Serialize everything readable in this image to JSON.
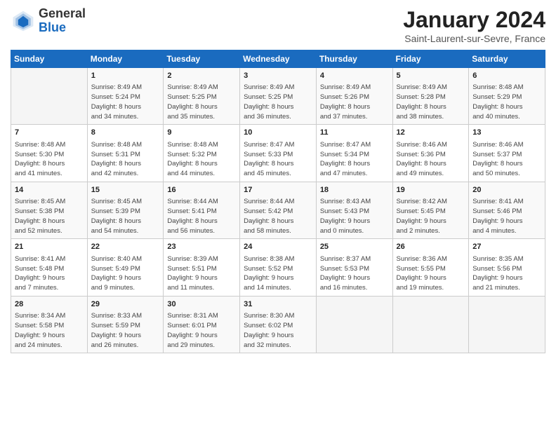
{
  "header": {
    "logo_general": "General",
    "logo_blue": "Blue",
    "title": "January 2024",
    "location": "Saint-Laurent-sur-Sevre, France"
  },
  "days_of_week": [
    "Sunday",
    "Monday",
    "Tuesday",
    "Wednesday",
    "Thursday",
    "Friday",
    "Saturday"
  ],
  "weeks": [
    [
      {
        "day": "",
        "sunrise": "",
        "sunset": "",
        "daylight": ""
      },
      {
        "day": "1",
        "sunrise": "Sunrise: 8:49 AM",
        "sunset": "Sunset: 5:24 PM",
        "daylight": "Daylight: 8 hours and 34 minutes."
      },
      {
        "day": "2",
        "sunrise": "Sunrise: 8:49 AM",
        "sunset": "Sunset: 5:25 PM",
        "daylight": "Daylight: 8 hours and 35 minutes."
      },
      {
        "day": "3",
        "sunrise": "Sunrise: 8:49 AM",
        "sunset": "Sunset: 5:25 PM",
        "daylight": "Daylight: 8 hours and 36 minutes."
      },
      {
        "day": "4",
        "sunrise": "Sunrise: 8:49 AM",
        "sunset": "Sunset: 5:26 PM",
        "daylight": "Daylight: 8 hours and 37 minutes."
      },
      {
        "day": "5",
        "sunrise": "Sunrise: 8:49 AM",
        "sunset": "Sunset: 5:28 PM",
        "daylight": "Daylight: 8 hours and 38 minutes."
      },
      {
        "day": "6",
        "sunrise": "Sunrise: 8:48 AM",
        "sunset": "Sunset: 5:29 PM",
        "daylight": "Daylight: 8 hours and 40 minutes."
      }
    ],
    [
      {
        "day": "7",
        "sunrise": "Sunrise: 8:48 AM",
        "sunset": "Sunset: 5:30 PM",
        "daylight": "Daylight: 8 hours and 41 minutes."
      },
      {
        "day": "8",
        "sunrise": "Sunrise: 8:48 AM",
        "sunset": "Sunset: 5:31 PM",
        "daylight": "Daylight: 8 hours and 42 minutes."
      },
      {
        "day": "9",
        "sunrise": "Sunrise: 8:48 AM",
        "sunset": "Sunset: 5:32 PM",
        "daylight": "Daylight: 8 hours and 44 minutes."
      },
      {
        "day": "10",
        "sunrise": "Sunrise: 8:47 AM",
        "sunset": "Sunset: 5:33 PM",
        "daylight": "Daylight: 8 hours and 45 minutes."
      },
      {
        "day": "11",
        "sunrise": "Sunrise: 8:47 AM",
        "sunset": "Sunset: 5:34 PM",
        "daylight": "Daylight: 8 hours and 47 minutes."
      },
      {
        "day": "12",
        "sunrise": "Sunrise: 8:46 AM",
        "sunset": "Sunset: 5:36 PM",
        "daylight": "Daylight: 8 hours and 49 minutes."
      },
      {
        "day": "13",
        "sunrise": "Sunrise: 8:46 AM",
        "sunset": "Sunset: 5:37 PM",
        "daylight": "Daylight: 8 hours and 50 minutes."
      }
    ],
    [
      {
        "day": "14",
        "sunrise": "Sunrise: 8:45 AM",
        "sunset": "Sunset: 5:38 PM",
        "daylight": "Daylight: 8 hours and 52 minutes."
      },
      {
        "day": "15",
        "sunrise": "Sunrise: 8:45 AM",
        "sunset": "Sunset: 5:39 PM",
        "daylight": "Daylight: 8 hours and 54 minutes."
      },
      {
        "day": "16",
        "sunrise": "Sunrise: 8:44 AM",
        "sunset": "Sunset: 5:41 PM",
        "daylight": "Daylight: 8 hours and 56 minutes."
      },
      {
        "day": "17",
        "sunrise": "Sunrise: 8:44 AM",
        "sunset": "Sunset: 5:42 PM",
        "daylight": "Daylight: 8 hours and 58 minutes."
      },
      {
        "day": "18",
        "sunrise": "Sunrise: 8:43 AM",
        "sunset": "Sunset: 5:43 PM",
        "daylight": "Daylight: 9 hours and 0 minutes."
      },
      {
        "day": "19",
        "sunrise": "Sunrise: 8:42 AM",
        "sunset": "Sunset: 5:45 PM",
        "daylight": "Daylight: 9 hours and 2 minutes."
      },
      {
        "day": "20",
        "sunrise": "Sunrise: 8:41 AM",
        "sunset": "Sunset: 5:46 PM",
        "daylight": "Daylight: 9 hours and 4 minutes."
      }
    ],
    [
      {
        "day": "21",
        "sunrise": "Sunrise: 8:41 AM",
        "sunset": "Sunset: 5:48 PM",
        "daylight": "Daylight: 9 hours and 7 minutes."
      },
      {
        "day": "22",
        "sunrise": "Sunrise: 8:40 AM",
        "sunset": "Sunset: 5:49 PM",
        "daylight": "Daylight: 9 hours and 9 minutes."
      },
      {
        "day": "23",
        "sunrise": "Sunrise: 8:39 AM",
        "sunset": "Sunset: 5:51 PM",
        "daylight": "Daylight: 9 hours and 11 minutes."
      },
      {
        "day": "24",
        "sunrise": "Sunrise: 8:38 AM",
        "sunset": "Sunset: 5:52 PM",
        "daylight": "Daylight: 9 hours and 14 minutes."
      },
      {
        "day": "25",
        "sunrise": "Sunrise: 8:37 AM",
        "sunset": "Sunset: 5:53 PM",
        "daylight": "Daylight: 9 hours and 16 minutes."
      },
      {
        "day": "26",
        "sunrise": "Sunrise: 8:36 AM",
        "sunset": "Sunset: 5:55 PM",
        "daylight": "Daylight: 9 hours and 19 minutes."
      },
      {
        "day": "27",
        "sunrise": "Sunrise: 8:35 AM",
        "sunset": "Sunset: 5:56 PM",
        "daylight": "Daylight: 9 hours and 21 minutes."
      }
    ],
    [
      {
        "day": "28",
        "sunrise": "Sunrise: 8:34 AM",
        "sunset": "Sunset: 5:58 PM",
        "daylight": "Daylight: 9 hours and 24 minutes."
      },
      {
        "day": "29",
        "sunrise": "Sunrise: 8:33 AM",
        "sunset": "Sunset: 5:59 PM",
        "daylight": "Daylight: 9 hours and 26 minutes."
      },
      {
        "day": "30",
        "sunrise": "Sunrise: 8:31 AM",
        "sunset": "Sunset: 6:01 PM",
        "daylight": "Daylight: 9 hours and 29 minutes."
      },
      {
        "day": "31",
        "sunrise": "Sunrise: 8:30 AM",
        "sunset": "Sunset: 6:02 PM",
        "daylight": "Daylight: 9 hours and 32 minutes."
      },
      {
        "day": "",
        "sunrise": "",
        "sunset": "",
        "daylight": ""
      },
      {
        "day": "",
        "sunrise": "",
        "sunset": "",
        "daylight": ""
      },
      {
        "day": "",
        "sunrise": "",
        "sunset": "",
        "daylight": ""
      }
    ]
  ]
}
